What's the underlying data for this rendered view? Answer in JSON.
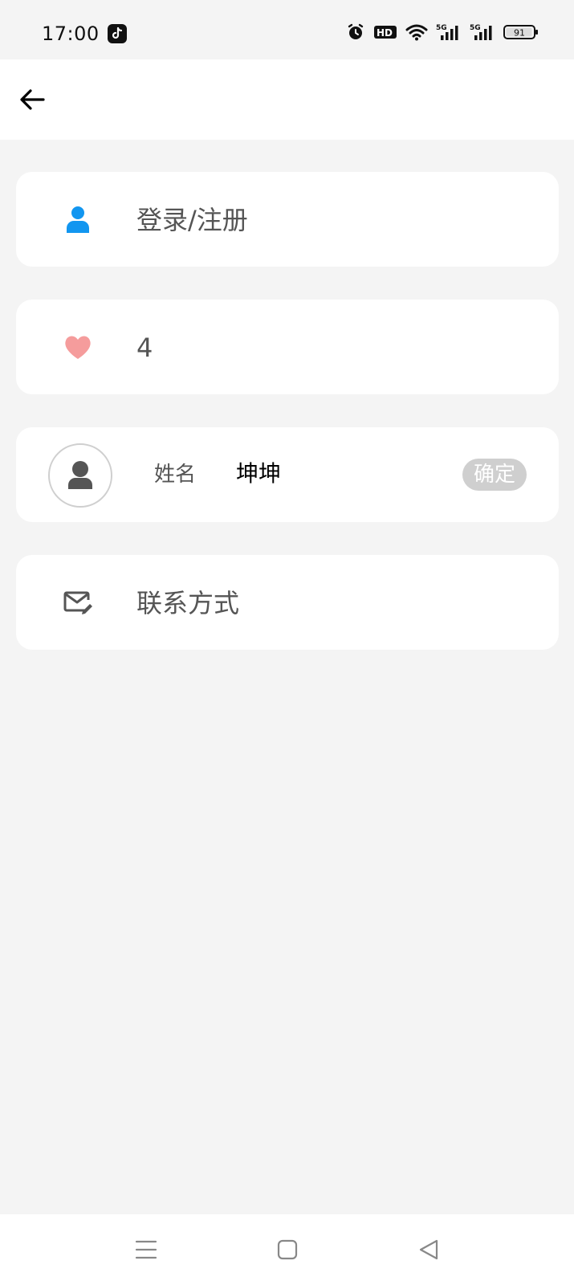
{
  "status_bar": {
    "time": "17:00",
    "battery": "91",
    "network1": "5G",
    "network2": "5G"
  },
  "header": {
    "back_icon": "arrow-left-icon"
  },
  "menu": {
    "login": {
      "icon": "user-icon",
      "label": "登录/注册",
      "icon_color": "#1296f0"
    },
    "likes": {
      "icon": "heart-icon",
      "value": "4",
      "icon_color": "#f59c9c"
    },
    "name": {
      "avatar_icon": "user-avatar-icon",
      "label": "姓名",
      "value": "坤坤",
      "confirm_label": "确定"
    },
    "contact": {
      "icon": "mail-edit-icon",
      "label": "联系方式"
    }
  },
  "nav_bar": {
    "menu_icon": "menu-icon",
    "home_icon": "home-square-icon",
    "back_icon": "back-triangle-icon"
  }
}
